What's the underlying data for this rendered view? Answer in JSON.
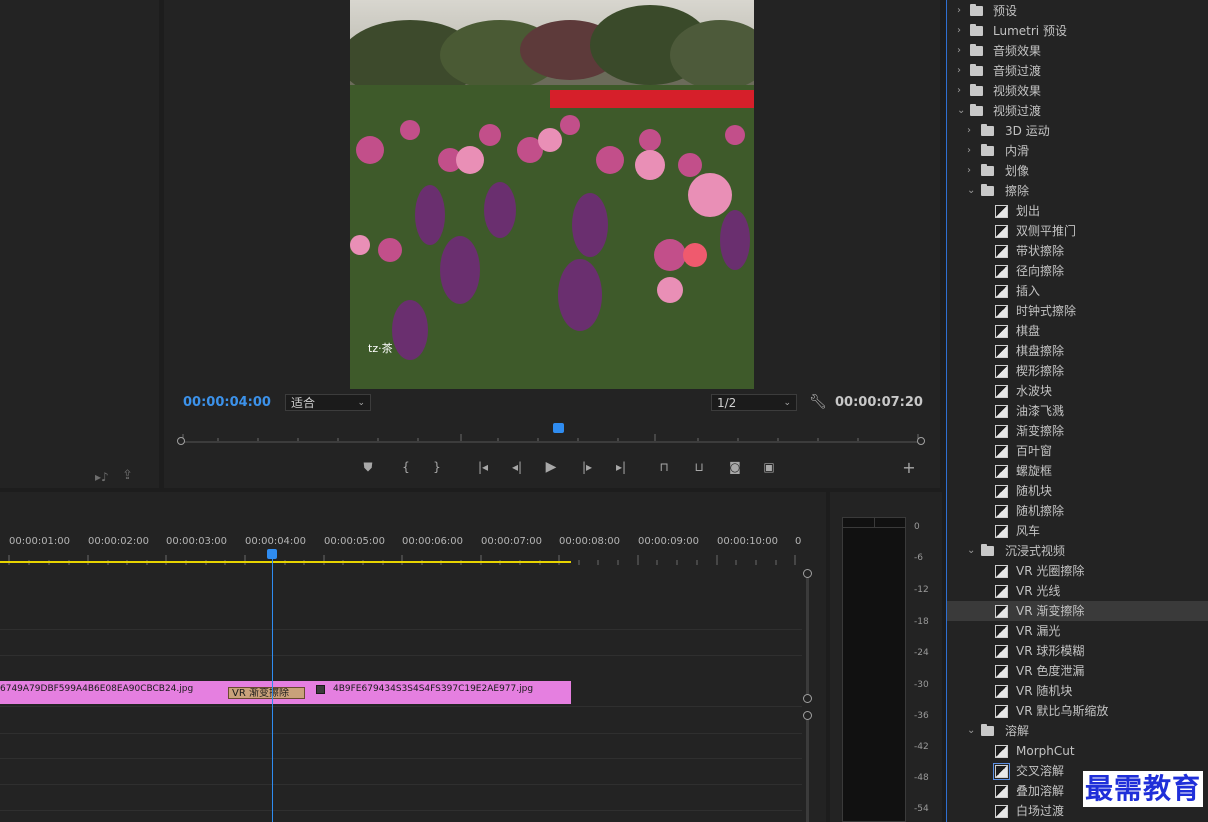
{
  "program": {
    "current_time": "00:00:04:00",
    "fit_value": "适合",
    "resolution_value": "1/2",
    "duration": "00:00:07:20",
    "frame_watermark": "tz·茶"
  },
  "timeline": {
    "ruler_labels": [
      "00:00:01:00",
      "00:00:02:00",
      "00:00:03:00",
      "00:00:04:00",
      "00:00:05:00",
      "00:00:06:00",
      "00:00:07:00",
      "00:00:08:00",
      "00:00:09:00",
      "00:00:10:00",
      "0"
    ],
    "clip_a_name": "6749A79DBF599A4B6E08EA90CBCB24.jpg",
    "transition_label": "VR 渐变擦除",
    "clip_b_name": "4B9FE679434S3S4S4FS397C19E2AE977.jpg"
  },
  "meter": {
    "db_labels": [
      "0",
      "-6",
      "-12",
      "-18",
      "-24",
      "-30",
      "-36",
      "-42",
      "-48",
      "-54"
    ]
  },
  "effects": {
    "items": [
      {
        "label": "预设",
        "type": "preset",
        "level": 0,
        "state": "collapsed"
      },
      {
        "label": "Lumetri 预设",
        "type": "preset",
        "level": 0,
        "state": "collapsed"
      },
      {
        "label": "音频效果",
        "type": "folder",
        "level": 0,
        "state": "collapsed"
      },
      {
        "label": "音频过渡",
        "type": "folder",
        "level": 0,
        "state": "collapsed"
      },
      {
        "label": "视频效果",
        "type": "folder",
        "level": 0,
        "state": "collapsed"
      },
      {
        "label": "视频过渡",
        "type": "folder",
        "level": 0,
        "state": "expanded"
      },
      {
        "label": "3D 运动",
        "type": "folder",
        "level": 1,
        "state": "collapsed"
      },
      {
        "label": "内滑",
        "type": "folder",
        "level": 1,
        "state": "collapsed"
      },
      {
        "label": "划像",
        "type": "folder",
        "level": 1,
        "state": "collapsed"
      },
      {
        "label": "擦除",
        "type": "folder",
        "level": 1,
        "state": "expanded"
      },
      {
        "label": "划出",
        "type": "fx",
        "level": 2
      },
      {
        "label": "双侧平推门",
        "type": "fx",
        "level": 2
      },
      {
        "label": "带状擦除",
        "type": "fx",
        "level": 2
      },
      {
        "label": "径向擦除",
        "type": "fx",
        "level": 2
      },
      {
        "label": "插入",
        "type": "fx",
        "level": 2
      },
      {
        "label": "时钟式擦除",
        "type": "fx",
        "level": 2
      },
      {
        "label": "棋盘",
        "type": "fx",
        "level": 2
      },
      {
        "label": "棋盘擦除",
        "type": "fx",
        "level": 2
      },
      {
        "label": "楔形擦除",
        "type": "fx",
        "level": 2
      },
      {
        "label": "水波块",
        "type": "fx",
        "level": 2
      },
      {
        "label": "油漆飞溅",
        "type": "fx",
        "level": 2
      },
      {
        "label": "渐变擦除",
        "type": "fx",
        "level": 2
      },
      {
        "label": "百叶窗",
        "type": "fx",
        "level": 2
      },
      {
        "label": "螺旋框",
        "type": "fx",
        "level": 2
      },
      {
        "label": "随机块",
        "type": "fx",
        "level": 2
      },
      {
        "label": "随机擦除",
        "type": "fx",
        "level": 2
      },
      {
        "label": "风车",
        "type": "fx",
        "level": 2
      },
      {
        "label": "沉浸式视频",
        "type": "folder",
        "level": 1,
        "state": "expanded"
      },
      {
        "label": "VR 光圈擦除",
        "type": "fx",
        "level": 2
      },
      {
        "label": "VR 光线",
        "type": "fx",
        "level": 2
      },
      {
        "label": "VR 渐变擦除",
        "type": "fx",
        "level": 2,
        "selected": true
      },
      {
        "label": "VR 漏光",
        "type": "fx",
        "level": 2
      },
      {
        "label": "VR 球形模糊",
        "type": "fx",
        "level": 2
      },
      {
        "label": "VR 色度泄漏",
        "type": "fx",
        "level": 2
      },
      {
        "label": "VR 随机块",
        "type": "fx",
        "level": 2
      },
      {
        "label": "VR 默比乌斯缩放",
        "type": "fx",
        "level": 2
      },
      {
        "label": "溶解",
        "type": "folder",
        "level": 1,
        "state": "expanded"
      },
      {
        "label": "MorphCut",
        "type": "fx",
        "level": 2
      },
      {
        "label": "交叉溶解",
        "type": "fx",
        "level": 2,
        "focus": true
      },
      {
        "label": "叠加溶解",
        "type": "fx",
        "level": 2
      },
      {
        "label": "白场过渡",
        "type": "fx",
        "level": 2
      }
    ]
  },
  "watermark": "最需教育",
  "colors": {
    "accent": "#2f8cf0",
    "clip": "#e57fe0",
    "work_area": "#e8d400",
    "transition": "#c9a17a"
  }
}
